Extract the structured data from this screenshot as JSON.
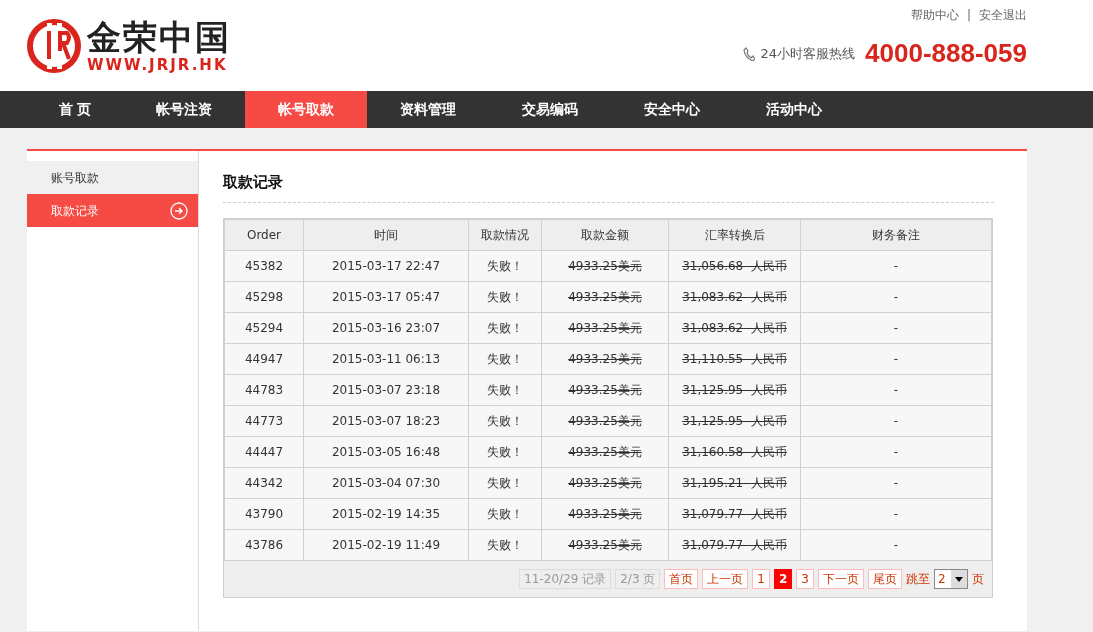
{
  "header": {
    "brand": "金荣中国",
    "domain": "WWW.JRJR.HK",
    "top_links": [
      "帮助中心",
      "安全退出"
    ],
    "separator": "|",
    "hotline_label": "24小时客服热线",
    "hotline": "4000-888-059"
  },
  "nav": [
    {
      "label": "首 页",
      "selected": false
    },
    {
      "label": "帐号注资",
      "selected": false
    },
    {
      "label": "帐号取款",
      "selected": true
    },
    {
      "label": "资料管理",
      "selected": false
    },
    {
      "label": "交易编码",
      "selected": false
    },
    {
      "label": "安全中心",
      "selected": false
    },
    {
      "label": "活动中心",
      "selected": false
    }
  ],
  "sidebar": {
    "items": [
      {
        "label": "账号取款",
        "selected": false
      },
      {
        "label": "取款记录",
        "selected": true
      }
    ]
  },
  "content": {
    "title": "取款记录",
    "table": {
      "columns": [
        "Order",
        "时间",
        "取款情况",
        "取款金额",
        "汇率转换后",
        "财务备注"
      ],
      "rows": [
        {
          "cells": [
            "45382",
            "2015-03-17 22:47",
            "失败！",
            "4933.25美元",
            "31,056.68  人民币",
            "-"
          ],
          "cancelled": true
        },
        {
          "cells": [
            "45298",
            "2015-03-17 05:47",
            "失败！",
            "4933.25美元",
            "31,083.62  人民币",
            "-"
          ],
          "cancelled": true
        },
        {
          "cells": [
            "45294",
            "2015-03-16 23:07",
            "失败！",
            "4933.25美元",
            "31,083.62  人民币",
            "-"
          ],
          "cancelled": true
        },
        {
          "cells": [
            "44947",
            "2015-03-11 06:13",
            "失败！",
            "4933.25美元",
            "31,110.55  人民币",
            "-"
          ],
          "cancelled": true
        },
        {
          "cells": [
            "44783",
            "2015-03-07 23:18",
            "失败！",
            "4933.25美元",
            "31,125.95  人民币",
            "-"
          ],
          "cancelled": true
        },
        {
          "cells": [
            "44773",
            "2015-03-07 18:23",
            "失败！",
            "4933.25美元",
            "31,125.95  人民币",
            "-"
          ],
          "cancelled": true
        },
        {
          "cells": [
            "44447",
            "2015-03-05 16:48",
            "失败！",
            "4933.25美元",
            "31,160.58  人民币",
            "-"
          ],
          "cancelled": true
        },
        {
          "cells": [
            "44342",
            "2015-03-04 07:30",
            "失败！",
            "4933.25美元",
            "31,195.21  人民币",
            "-"
          ],
          "cancelled": true
        },
        {
          "cells": [
            "43790",
            "2015-02-19 14:35",
            "失败！",
            "4933.25美元",
            "31,079.77  人民币",
            "-"
          ],
          "cancelled": true
        },
        {
          "cells": [
            "43786",
            "2015-02-19 11:49",
            "失败！",
            "4933.25美元",
            "31,079.77  人民币",
            "-"
          ],
          "cancelled": true
        }
      ]
    },
    "pagination": {
      "items": [
        {
          "label": "11-20/29 记录",
          "disabled": true
        },
        {
          "label": "2/3 页",
          "disabled": true
        },
        {
          "label": "首页",
          "disabled": false,
          "selected": false
        },
        {
          "label": "上一页",
          "disabled": false,
          "selected": false
        },
        {
          "label": "1",
          "disabled": false,
          "selected": false
        },
        {
          "label": "2",
          "disabled": false,
          "selected": true
        },
        {
          "label": "3",
          "disabled": false,
          "selected": false
        },
        {
          "label": "下一页",
          "disabled": false,
          "selected": false
        },
        {
          "label": "尾页",
          "disabled": false,
          "selected": false
        }
      ],
      "jump_label": "跳至",
      "jump_value": "2",
      "jump_suffix": "页"
    }
  }
}
